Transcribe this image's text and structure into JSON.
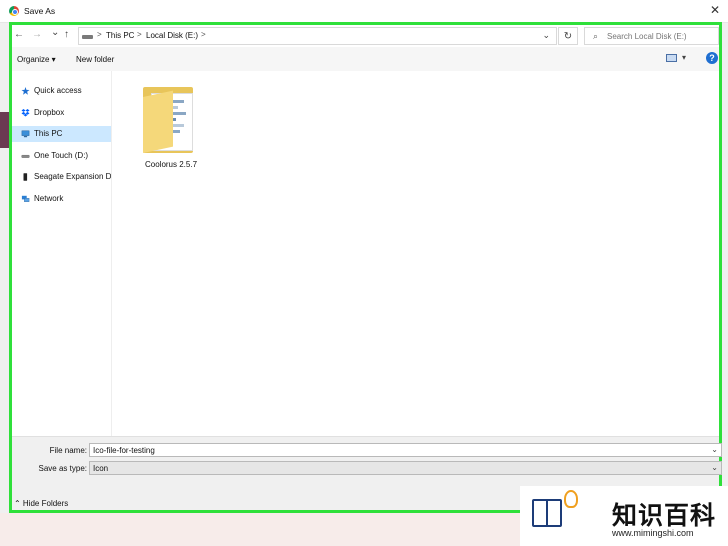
{
  "window": {
    "title": "Save As",
    "close_glyph": "✕"
  },
  "nav": {
    "back_glyph": "←",
    "forward_glyph": "→",
    "recent_glyph": "⌄",
    "up_glyph": "↑",
    "breadcrumbs": [
      "This PC",
      "Local Disk (E:)"
    ],
    "separator": ">",
    "dropdown_glyph": "⌄",
    "refresh_glyph": "↻",
    "search_placeholder": "Search Local Disk (E:)",
    "search_glyph": "⌕"
  },
  "toolbar": {
    "organize_label": "Organize ▾",
    "new_folder_label": "New folder",
    "view_dropdown_glyph": "▾",
    "help_glyph": "?"
  },
  "sidebar": {
    "items": [
      {
        "label": "Quick access",
        "icon": "star-icon",
        "color": "#1f6fd1"
      },
      {
        "label": "Dropbox",
        "icon": "dropbox-icon",
        "color": "#0061fe"
      },
      {
        "label": "This PC",
        "icon": "computer-icon",
        "color": "#3a8fd9",
        "selected": true
      },
      {
        "label": "One Touch (D:)",
        "icon": "drive-icon",
        "color": "#555555"
      },
      {
        "label": "Seagate Expansion D",
        "icon": "usb-drive-icon",
        "color": "#222222"
      },
      {
        "label": "Network",
        "icon": "network-icon",
        "color": "#2a7fd4"
      }
    ]
  },
  "files": [
    {
      "name": "Coolorus 2.5.7",
      "type": "folder"
    }
  ],
  "form": {
    "file_name_label": "File name:",
    "file_name_value": "Ico-file-for-testing",
    "save_type_label": "Save as type:",
    "save_type_value": "Icon",
    "dropdown_glyph": "⌄",
    "hide_folders_label": "⌃ Hide Folders"
  },
  "watermark": {
    "chinese_text": "知识百科",
    "url": "www.mimingshi.com"
  },
  "colors": {
    "highlight_frame": "#2fe03a",
    "selection": "#cce8ff",
    "folder": "#f5d87a"
  }
}
